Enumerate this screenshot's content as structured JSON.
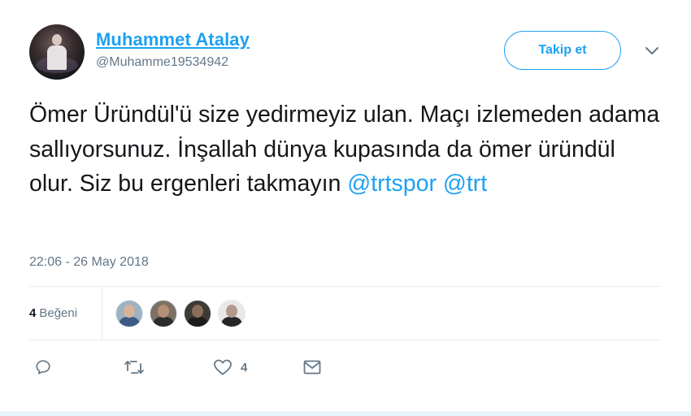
{
  "author": {
    "display_name": "Muhammet Atalay",
    "handle": "@Muhamme19534942"
  },
  "follow_button": {
    "label": "Takip et"
  },
  "tweet": {
    "text_parts": [
      "Ömer Üründül'ü size yedirmeyiz ulan. Maçı izlemeden adama sallıyorsunuz. İnşallah dünya kupasında da ömer üründül olur. Siz bu ergenleri takmayın ",
      "@trtspor",
      " ",
      "@trt"
    ],
    "timestamp": "22:06 - 26 May 2018"
  },
  "stats": {
    "likes_count": "4",
    "likes_label": "Beğeni"
  },
  "actions": {
    "like_count": "4",
    "icons": [
      "reply-icon",
      "retweet-icon",
      "heart-icon",
      "direct-message-icon"
    ]
  },
  "colors": {
    "accent": "#1da1f2",
    "text": "#14171a",
    "secondary": "#657786",
    "divider": "#e6ecf0"
  }
}
